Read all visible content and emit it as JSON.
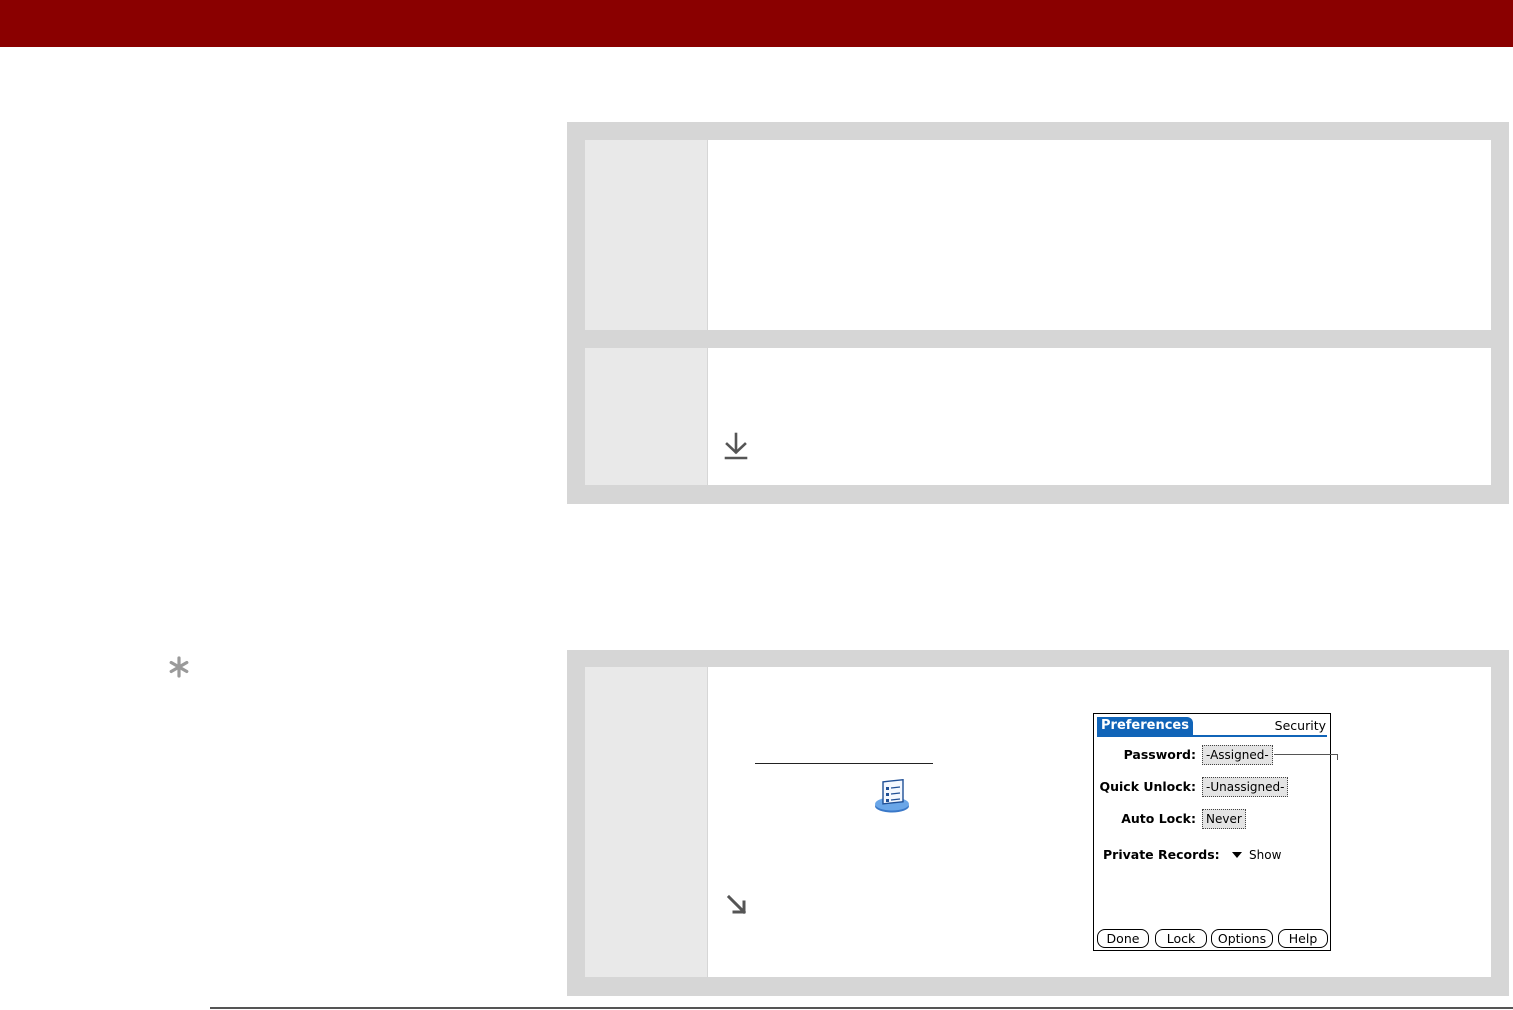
{
  "colors": {
    "header_bar": "#8a0000",
    "panel": "#d6d6d6",
    "step_cell": "#e9e9e9",
    "palm_accent": "#1064b8"
  },
  "icons": {
    "download_arrow": "arrow-down-to-line-icon",
    "done_arrow": "arrow-down-right-icon",
    "tip": "asterisk-icon",
    "preferences_app": "preferences-app-icon"
  },
  "palm_screen": {
    "tab_title": "Preferences",
    "panel_title": "Security",
    "fields": {
      "password_label": "Password:",
      "password_value": "-Assigned-",
      "quick_unlock_label": "Quick Unlock:",
      "quick_unlock_value": "-Unassigned-",
      "auto_lock_label": "Auto Lock:",
      "auto_lock_value": "Never",
      "private_records_label": "Private Records:",
      "private_records_value": "Show"
    },
    "buttons": {
      "done": "Done",
      "lock": "Lock",
      "options": "Options",
      "help": "Help"
    }
  }
}
